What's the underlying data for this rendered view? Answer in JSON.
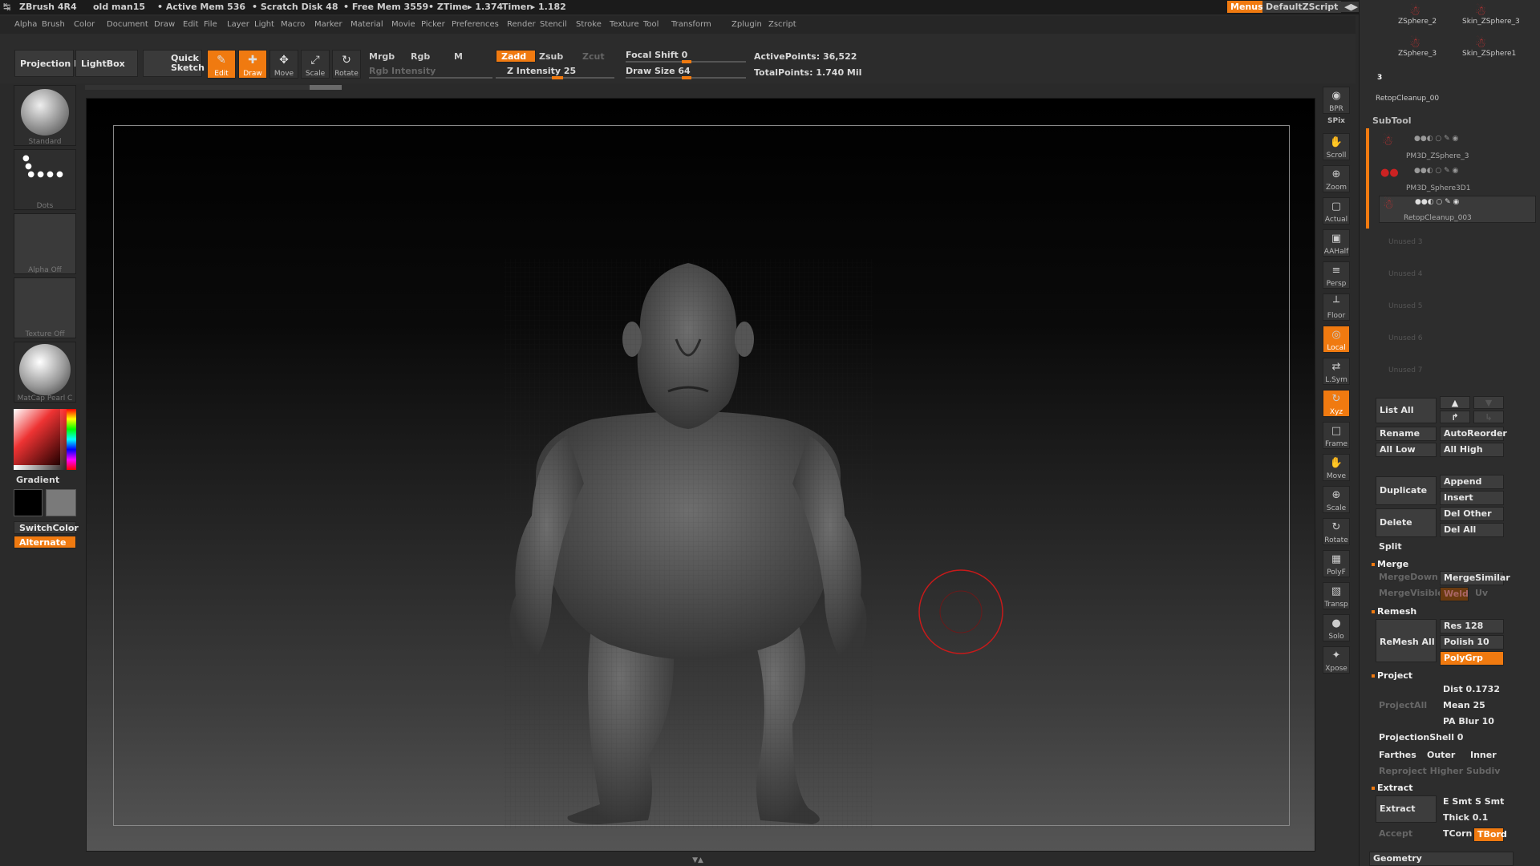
{
  "title_bar": {
    "app": "ZBrush 4R4",
    "doc": "old man15",
    "active_mem": "• Active Mem 536",
    "scratch": "• Scratch Disk 48",
    "free_mem": "• Free Mem 3559",
    "ztime": "• ZTime▸ 1.374",
    "timer": "Timer▸ 1.182",
    "menus_btn": "Menus",
    "script_btn": "DefaultZScript"
  },
  "menu": [
    "Alpha",
    "Brush",
    "Color",
    "Document",
    "Draw",
    "Edit",
    "File",
    "Layer",
    "Light",
    "Macro",
    "Marker",
    "Material",
    "Movie",
    "Picker",
    "Preferences",
    "Render",
    "Stencil",
    "Stroke",
    "Texture",
    "Tool",
    "Transform",
    "Zplugin",
    "Zscript"
  ],
  "toolbar": {
    "projection_master": "Projection Master",
    "lightbox": "LightBox",
    "quick_sketch": "Quick Sketch",
    "edit": "Edit",
    "draw": "Draw",
    "move": "Move",
    "scale": "Scale",
    "rotate": "Rotate",
    "mrgb": "Mrgb",
    "rgb": "Rgb",
    "m": "M",
    "rgb_intensity": "Rgb Intensity",
    "zadd": "Zadd",
    "zsub": "Zsub",
    "zcut": "Zcut",
    "z_intensity": "Z Intensity 25",
    "focal_shift": "Focal Shift 0",
    "draw_size": "Draw Size 64",
    "active_points": "ActivePoints: 36,522",
    "total_points": "TotalPoints: 1.740 Mil"
  },
  "left_shelf": {
    "brush": "Standard",
    "stroke": "Dots",
    "alpha": "Alpha Off",
    "texture": "Texture Off",
    "material": "MatCap Pearl C",
    "gradient": "Gradient",
    "switch_color": "SwitchColor",
    "alternate": "Alternate"
  },
  "right_shelf": [
    "BPR",
    "SPix",
    "Scroll",
    "Zoom",
    "Actual",
    "AAHalf",
    "Persp",
    "Floor",
    "Local",
    "L.Sym",
    "Xyz",
    "Frame",
    "Move",
    "Scale",
    "Rotate",
    "PolyF",
    "Transp",
    "Solo",
    "Xpose"
  ],
  "tray": {
    "tools": [
      "ZSphere_2",
      "Skin_ZSphere_3",
      "ZSphere_3",
      "Skin_ZSphere1",
      "RetopCleanup_00"
    ],
    "tool_count": "3",
    "subtool_title": "SubTool",
    "subtools": [
      "PM3D_ZSphere_3",
      "PM3D_Sphere3D1",
      "RetopCleanup_003"
    ],
    "unused": [
      "Unused 3",
      "Unused 4",
      "Unused 5",
      "Unused 6",
      "Unused 7"
    ],
    "list_all": "List All",
    "rename": "Rename",
    "auto_reorder": "AutoReorder",
    "all_low": "All Low",
    "all_high": "All High",
    "duplicate": "Duplicate",
    "append": "Append",
    "insert": "Insert",
    "delete": "Delete",
    "del_other": "Del Other",
    "del_all": "Del All",
    "split": "Split",
    "merge": "Merge",
    "merge_down": "MergeDown",
    "merge_similar": "MergeSimilar",
    "merge_visible": "MergeVisible",
    "weld": "Weld",
    "uv": "Uv",
    "remesh": "Remesh",
    "remesh_all": "ReMesh All",
    "res": "Res 128",
    "polish": "Polish 10",
    "polygrp": "PolyGrp",
    "project": "Project",
    "project_all": "ProjectAll",
    "dist": "Dist 0.1732",
    "mean": "Mean 25",
    "pa_blur": "PA Blur 10",
    "projection_shell": "ProjectionShell 0",
    "farthest": "Farthes",
    "outer": "Outer",
    "inner": "Inner",
    "reproject": "Reproject Higher Subdiv",
    "extract": "Extract",
    "extract_btn": "Extract",
    "e_smt": "E Smt",
    "s_smt": "S Smt",
    "thick": "Thick 0.1",
    "accept": "Accept",
    "tcorn": "TCorn",
    "tbord": "TBord",
    "geometry": "Geometry"
  },
  "colors": {
    "accent": "#f07a10",
    "bg": "#2a2a2a",
    "cursor": "#c81a1a"
  }
}
